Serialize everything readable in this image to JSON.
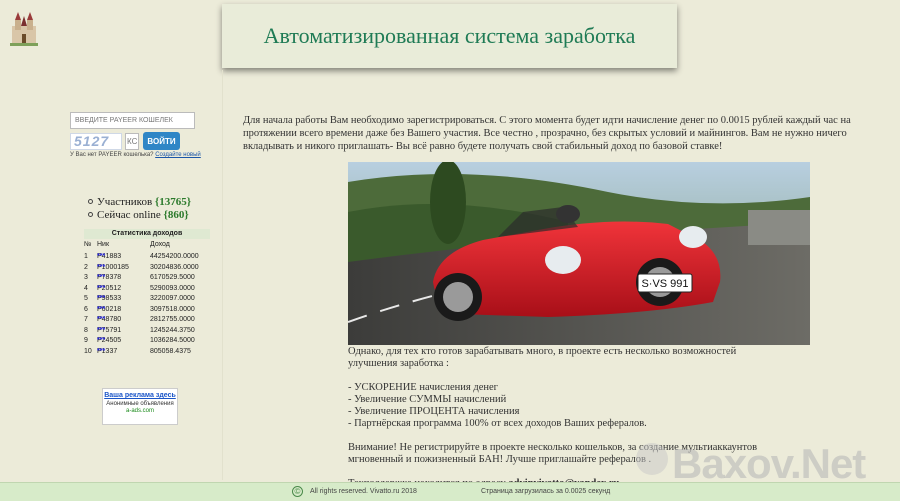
{
  "header": {
    "title": "Автоматизированная система заработка"
  },
  "login": {
    "wallet_placeholder": "ВВЕДИТЕ PAYEER КОШЕЛЕК",
    "captcha_text": "5127",
    "captcha_input_value": "КС",
    "login_button": "ВОЙТИ",
    "no_wallet_text": "У Вас нет PAYEER кошелька?",
    "create_link": "Создайте новый"
  },
  "counts": {
    "participants_label": "Участников",
    "participants_value": "{13765}",
    "online_label": "Сейчас online",
    "online_value": "{860}"
  },
  "stats": {
    "title": "Статистика доходов",
    "headers": {
      "num": "№",
      "nick": "Ник",
      "income": "Доход"
    },
    "rows": [
      {
        "num": "1",
        "nick": "P41883",
        "stars": "***",
        "income": "44254200.0000"
      },
      {
        "num": "2",
        "nick": "P1000185",
        "stars": "***",
        "income": "30204836.0000"
      },
      {
        "num": "3",
        "nick": "P78378",
        "stars": "***",
        "income": "6170529.5000"
      },
      {
        "num": "4",
        "nick": "P20512",
        "stars": "***",
        "income": "5290093.0000"
      },
      {
        "num": "5",
        "nick": "P98533",
        "stars": "***",
        "income": "3220097.0000"
      },
      {
        "num": "6",
        "nick": "P60218",
        "stars": "***",
        "income": "3097518.0000"
      },
      {
        "num": "7",
        "nick": "P48780",
        "stars": "***",
        "income": "2812755.0000"
      },
      {
        "num": "8",
        "nick": "P75791",
        "stars": "***",
        "income": "1245244.3750"
      },
      {
        "num": "9",
        "nick": "P24505",
        "stars": "***",
        "income": "1036284.5000"
      },
      {
        "num": "10",
        "nick": "P1337",
        "stars": "***",
        "income": "805058.4375"
      }
    ]
  },
  "ad": {
    "title": "Ваша реклама здесь",
    "subtitle": "Анонимные объявления",
    "domain": "a-ads.com"
  },
  "intro": {
    "text": "Для начала работы Вам необходимо зарегистрироваться. С этого момента будет идти начисление денег по 0.0015 рублей каждый час на протяжении всего времени даже без Вашего участия. Все честно , прозрачно, без скрытых условий и майнингов. Вам не нужно ничего вкладывать и никого приглашать- Вы всё равно будете получать свой стабильный доход по базовой ставке!"
  },
  "car": {
    "plate": "S·VS 991"
  },
  "features": {
    "lead_1": "Однако, для тех кто готов зарабатывать много, в проекте есть несколько возможностей",
    "lead_2": "улучшения заработка :",
    "items": [
      "- УСКОРЕНИЕ начисления денег",
      "- Увеличение СУММЫ начислений",
      "- Увеличение ПРОЦЕНТА начисления",
      "- Партнёрская программа 100% от всех доходов Ваших рефералов."
    ],
    "warning_1": "Внимание! Не регистрируйте в проекте несколько кошельков, за создание мультиаккаунтов",
    "warning_2": "мгновенный и пожизненный БАН! Лучше приглашайте рефералов .",
    "support_prefix": "Техподдержка находится по адресу ",
    "support_email": "advinvivatto@yandex.ru"
  },
  "watermark": {
    "text": "Baxov.Net"
  },
  "footer": {
    "copyright_symbol": "©",
    "rights": "All rights reserved. Vivatto.ru 2018",
    "load": "Страница загрузилась за 0.0025 секунд"
  }
}
